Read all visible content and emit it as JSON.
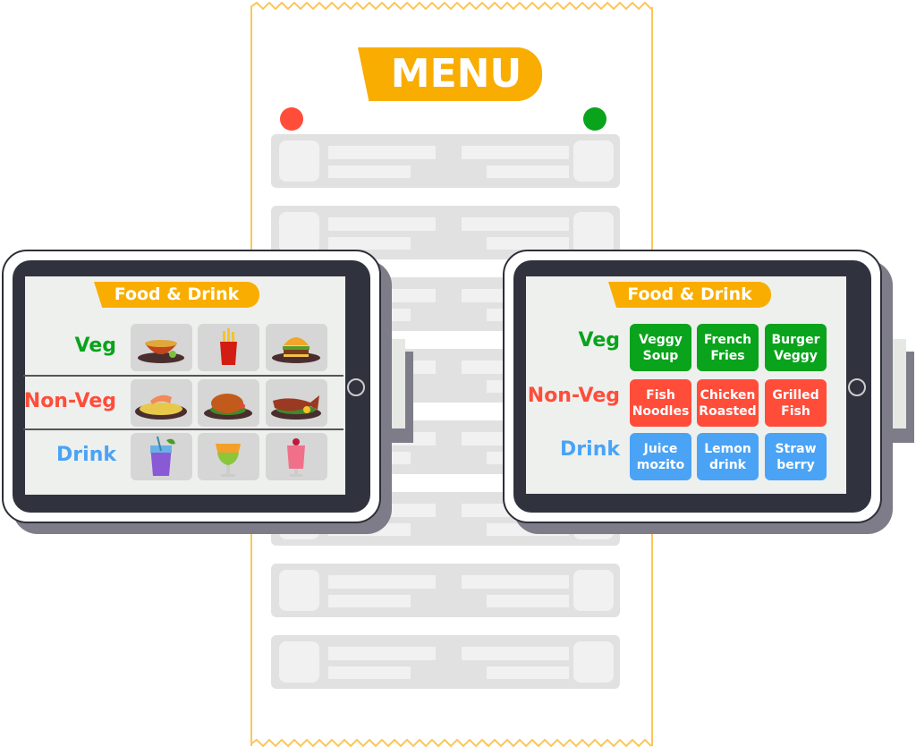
{
  "menu": {
    "title": "MENU",
    "rows": 8
  },
  "colors": {
    "accent": "#f9ad00",
    "veg": "#0aa31c",
    "nonveg": "#ff4d3a",
    "drink": "#4aa3f5",
    "red_dot": "#ff4d3a",
    "green_dot": "#0aa31c"
  },
  "left_tablet": {
    "title": "Food & Drink",
    "categories": [
      {
        "label": "Veg",
        "items": [
          "soup-icon",
          "fries-icon",
          "burger-icon"
        ]
      },
      {
        "label": "Non-Veg",
        "items": [
          "shrimp-noodles-icon",
          "roast-chicken-icon",
          "grilled-fish-icon"
        ]
      },
      {
        "label": "Drink",
        "items": [
          "purple-cocktail-icon",
          "fruit-juice-icon",
          "strawberry-shake-icon"
        ]
      }
    ]
  },
  "right_tablet": {
    "title": "Food & Drink",
    "categories": [
      {
        "label": "Veg",
        "items": [
          "Veggy\nSoup",
          "French\nFries",
          "Burger\nVeggy"
        ]
      },
      {
        "label": "Non-Veg",
        "items": [
          "Fish\nNoodles",
          "Chicken\nRoasted",
          "Grilled\nFish"
        ]
      },
      {
        "label": "Drink",
        "items": [
          "Juice\nmozito",
          "Lemon\ndrink",
          "Straw\nberry"
        ]
      }
    ]
  }
}
